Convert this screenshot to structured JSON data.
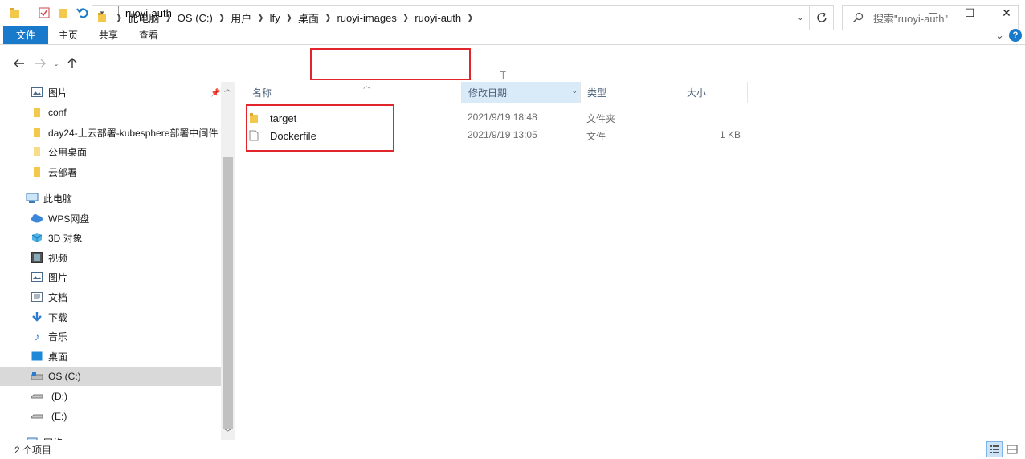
{
  "window": {
    "title": "ruoyi-auth",
    "minimize": "─",
    "maximize": "☐",
    "close": "✕"
  },
  "ribbon": {
    "tabs": [
      "文件",
      "主页",
      "共享",
      "查看"
    ],
    "collapse": "⌄",
    "help": "?"
  },
  "address": {
    "crumbs": [
      "此电脑",
      "OS (C:)",
      "用户",
      "lfy",
      "桌面",
      "ruoyi-images",
      "ruoyi-auth"
    ],
    "search_placeholder": "搜索\"ruoyi-auth\""
  },
  "nav": {
    "quick_access": [
      {
        "label": "图片",
        "icon": "pictures-icon"
      },
      {
        "label": "conf",
        "icon": "folder-icon"
      },
      {
        "label": "day24-上云部署-kubesphere部署中间件",
        "icon": "folder-icon"
      },
      {
        "label": "公用桌面",
        "icon": "folder-icon"
      },
      {
        "label": "云部署",
        "icon": "folder-icon"
      }
    ],
    "this_pc": {
      "label": "此电脑",
      "icon": "computer-icon"
    },
    "pc_items": [
      {
        "label": "WPS网盘",
        "icon": "cloud-icon"
      },
      {
        "label": "3D 对象",
        "icon": "cube-icon"
      },
      {
        "label": "视频",
        "icon": "video-icon"
      },
      {
        "label": "图片",
        "icon": "pictures-icon"
      },
      {
        "label": "文档",
        "icon": "document-icon"
      },
      {
        "label": "下载",
        "icon": "download-icon"
      },
      {
        "label": "音乐",
        "icon": "music-icon"
      },
      {
        "label": "桌面",
        "icon": "desktop-icon"
      },
      {
        "label": "OS (C:)",
        "icon": "drive-icon",
        "selected": true
      },
      {
        "label": "(D:)",
        "icon": "drive-icon"
      },
      {
        "label": "(E:)",
        "icon": "drive-icon"
      },
      {
        "label": "网络",
        "icon": "network-icon"
      }
    ]
  },
  "columns": {
    "name": "名称",
    "modified": "修改日期",
    "type": "类型",
    "size": "大小"
  },
  "files": [
    {
      "name": "target",
      "modified": "2021/9/19 18:48",
      "type": "文件夹",
      "size": "",
      "icon": "folder-icon"
    },
    {
      "name": "Dockerfile",
      "modified": "2021/9/19 13:05",
      "type": "文件",
      "size": "1 KB",
      "icon": "file-icon"
    }
  ],
  "status": {
    "count": "2 个项目"
  },
  "colors": {
    "accent": "#1979ca",
    "highlight": "#e0262b",
    "folder": "#f2c94c",
    "selection": "#d9d9d9"
  }
}
